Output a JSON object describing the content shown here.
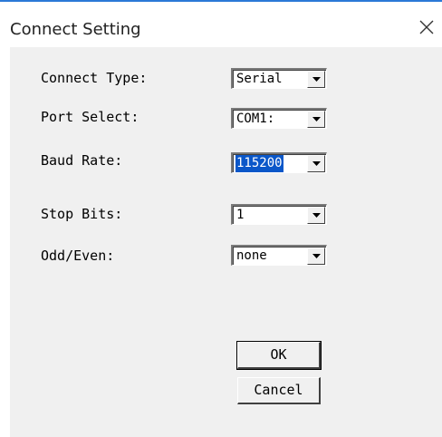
{
  "window": {
    "title": "Connect Setting"
  },
  "fields": [
    {
      "label": "Connect Type:",
      "value": "Serial",
      "selected": false
    },
    {
      "label": "Port Select:",
      "value": "COM1:",
      "selected": false
    },
    {
      "label": "Baud Rate:",
      "value": "115200",
      "selected": true
    },
    {
      "label": "Stop Bits:",
      "value": "1",
      "selected": false
    },
    {
      "label": "Odd/Even:",
      "value": "none",
      "selected": false
    }
  ],
  "buttons": {
    "ok": "OK",
    "cancel": "Cancel"
  },
  "colors": {
    "accent": "#2b79d7",
    "selection": "#0a57c9",
    "dialog_bg": "#f0f0f0"
  },
  "icons": {
    "close": "close-icon",
    "dropdown": "chevron-down-icon"
  }
}
